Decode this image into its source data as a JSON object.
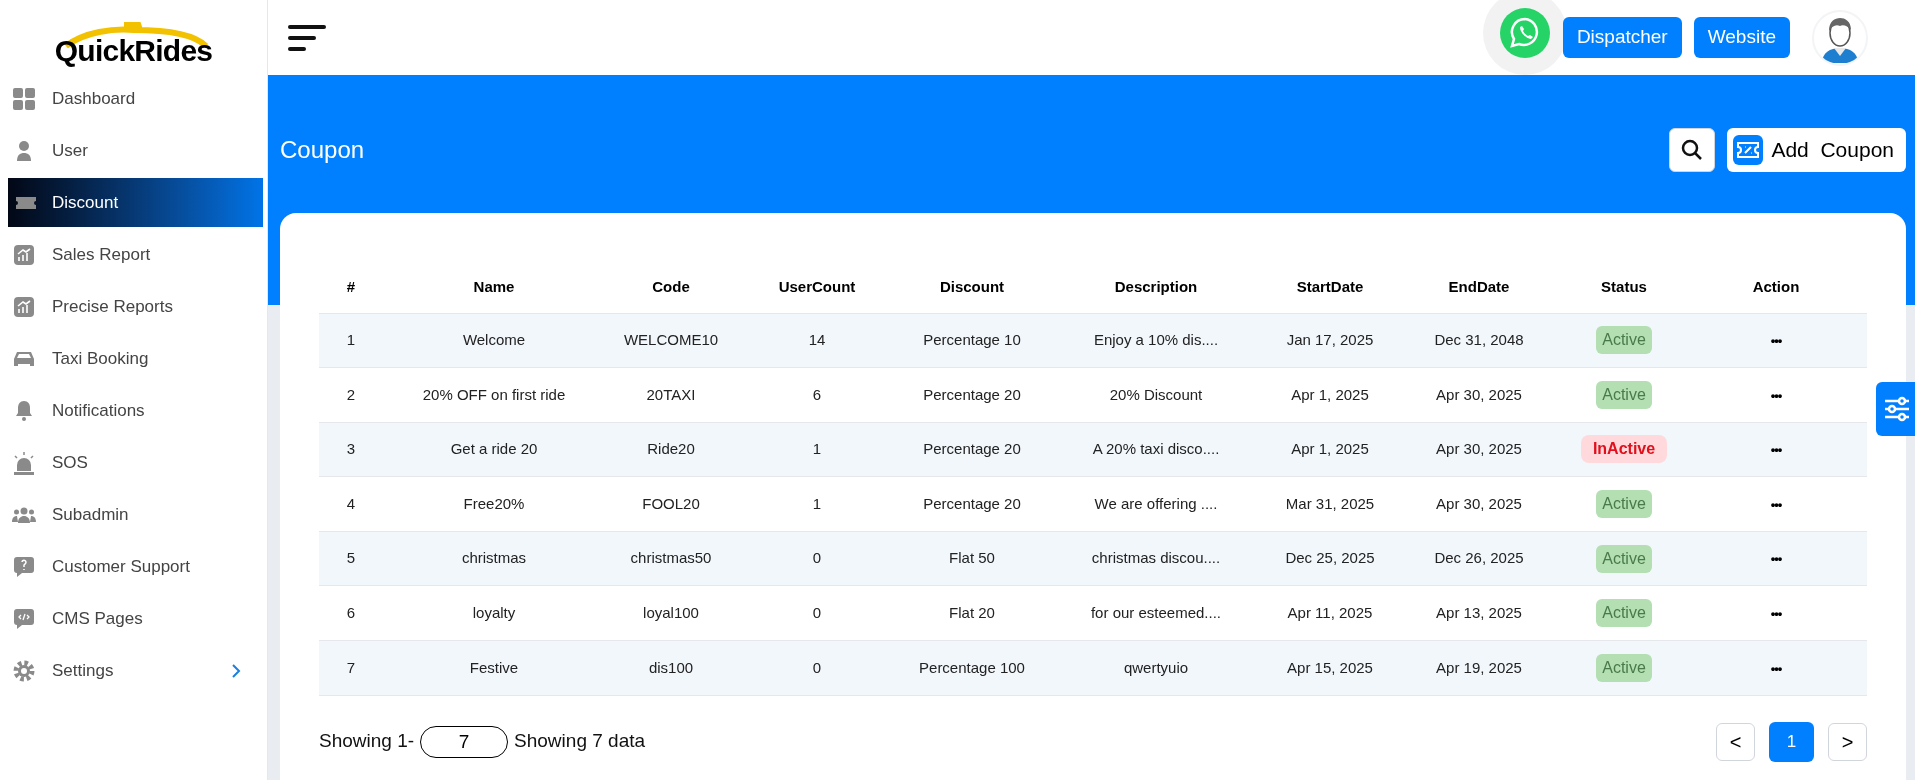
{
  "logo": {
    "text": "QuickRides"
  },
  "sidebar": {
    "items": [
      {
        "label": "Dashboard",
        "selected": false
      },
      {
        "label": "User",
        "selected": false
      },
      {
        "label": "Discount",
        "selected": true
      },
      {
        "label": "Sales Report",
        "selected": false
      },
      {
        "label": "Precise Reports",
        "selected": false
      },
      {
        "label": "Taxi Booking",
        "selected": false
      },
      {
        "label": "Notifications",
        "selected": false
      },
      {
        "label": "SOS",
        "selected": false
      },
      {
        "label": "Subadmin",
        "selected": false
      },
      {
        "label": "Customer Support",
        "selected": false
      },
      {
        "label": "CMS Pages",
        "selected": false
      },
      {
        "label": "Settings",
        "selected": false,
        "has_submenu": true
      }
    ]
  },
  "header": {
    "buttons": [
      "Dispatcher",
      "Website"
    ]
  },
  "page": {
    "title": "Coupon",
    "add_button": "Add  Coupon"
  },
  "table": {
    "columns": [
      "#",
      "Name",
      "Code",
      "UserCount",
      "Discount",
      "Description",
      "StartDate",
      "EndDate",
      "Status",
      "Action"
    ],
    "rows": [
      {
        "cells": [
          "1",
          "Welcome",
          "WELCOME10",
          "14",
          "Percentage 10",
          "Enjoy a 10% dis....",
          "Jan 17, 2025",
          "Dec 31, 2048"
        ],
        "status": "Active",
        "active": true,
        "action": "•••"
      },
      {
        "cells": [
          "2",
          "20% OFF on first ride",
          "20TAXI",
          "6",
          "Percentage 20",
          "20% Discount",
          "Apr 1, 2025",
          "Apr 30, 2025"
        ],
        "status": "Active",
        "active": true,
        "action": "•••"
      },
      {
        "cells": [
          "3",
          "Get a ride 20",
          "Ride20",
          "1",
          "Percentage 20",
          "A 20% taxi disco....",
          "Apr 1, 2025",
          "Apr 30, 2025"
        ],
        "status": "InActive",
        "active": false,
        "action": "•••"
      },
      {
        "cells": [
          "4",
          "Free20%",
          "FOOL20",
          "1",
          "Percentage 20",
          "We are offering ....",
          "Mar 31, 2025",
          "Apr 30, 2025"
        ],
        "status": "Active",
        "active": true,
        "action": "•••"
      },
      {
        "cells": [
          "5",
          "christmas",
          "christmas50",
          "0",
          "Flat 50",
          "christmas discou....",
          "Dec 25, 2025",
          "Dec 26, 2025"
        ],
        "status": "Active",
        "active": true,
        "action": "•••"
      },
      {
        "cells": [
          "6",
          "loyalty",
          "loyal100",
          "0",
          "Flat 20",
          "for our esteemed....",
          "Apr 11, 2025",
          "Apr 13, 2025"
        ],
        "status": "Active",
        "active": true,
        "action": "•••"
      },
      {
        "cells": [
          "7",
          "Festive",
          "dis100",
          "0",
          "Percentage 100",
          "qwertyuio",
          "Apr 15, 2025",
          "Apr 19, 2025"
        ],
        "status": "Active",
        "active": true,
        "action": "•••"
      }
    ]
  },
  "footer": {
    "prefix": "Showing 1-",
    "page_size": "7",
    "suffix": "Showing 7 data"
  },
  "pagination": {
    "prev": "<",
    "pages": [
      {
        "label": "1",
        "selected": true
      }
    ],
    "next": ">"
  }
}
